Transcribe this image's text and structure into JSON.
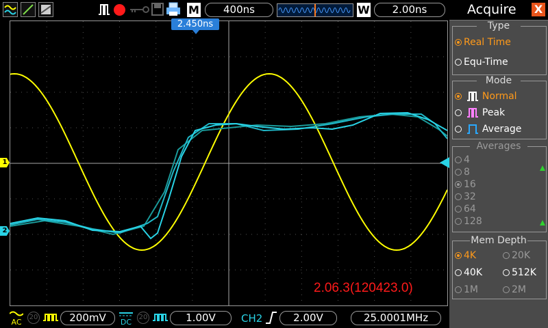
{
  "top_bar": {
    "timebase": "400ns",
    "mode_label": "M",
    "window_label": "W",
    "window_value": "2.00ns",
    "trigger_position": "2.450ns"
  },
  "bottom_bar": {
    "ch1": {
      "coupling": "AC",
      "bw_number": "20",
      "volts_div": "200mV",
      "color": "#ffff00"
    },
    "ch2": {
      "coupling": "DC",
      "bw_number": "20",
      "volts_div": "1.00V",
      "color": "#29d3e6"
    },
    "trigger": {
      "source": "CH2",
      "edge": "rising",
      "level": "2.00V"
    },
    "frequency": "25.0001MHz"
  },
  "overlay": {
    "firmware": "2.06.3(120423.0)",
    "ch1_marker": "1",
    "ch2_marker": "2"
  },
  "panel": {
    "title": "Acquire",
    "close_icon": "X",
    "type": {
      "title": "Type",
      "options": [
        {
          "label": "Real Time",
          "selected": true
        },
        {
          "label": "Equ-Time",
          "selected": false
        }
      ]
    },
    "mode": {
      "title": "Mode",
      "options": [
        {
          "label": "Normal",
          "selected": true,
          "icon": "normal-pulse-icon",
          "icon_color": "#ffffff"
        },
        {
          "label": "Peak",
          "selected": false,
          "icon": "peak-pulse-icon",
          "icon_color": "#ff80ff"
        },
        {
          "label": "Average",
          "selected": false,
          "icon": "average-pulse-icon",
          "icon_color": "#29a9ff"
        }
      ]
    },
    "averages": {
      "title": "Averages",
      "options": [
        "4",
        "8",
        "16",
        "32",
        "64",
        "128"
      ],
      "selected": "16"
    },
    "mem_depth": {
      "title": "Mem Depth",
      "options": [
        "4K",
        "20K",
        "40K",
        "512K",
        "1M",
        "2M"
      ],
      "selected": "4K",
      "disabled": [
        "1M",
        "2M"
      ]
    }
  },
  "colors": {
    "ch1": "#ffff00",
    "ch2": "#29d3e6",
    "ch2_shadow": "#1a9a9a",
    "accent_selected": "#ff9a1a",
    "firmware_text": "#ff1a1a",
    "close_button": "#e8541b"
  }
}
